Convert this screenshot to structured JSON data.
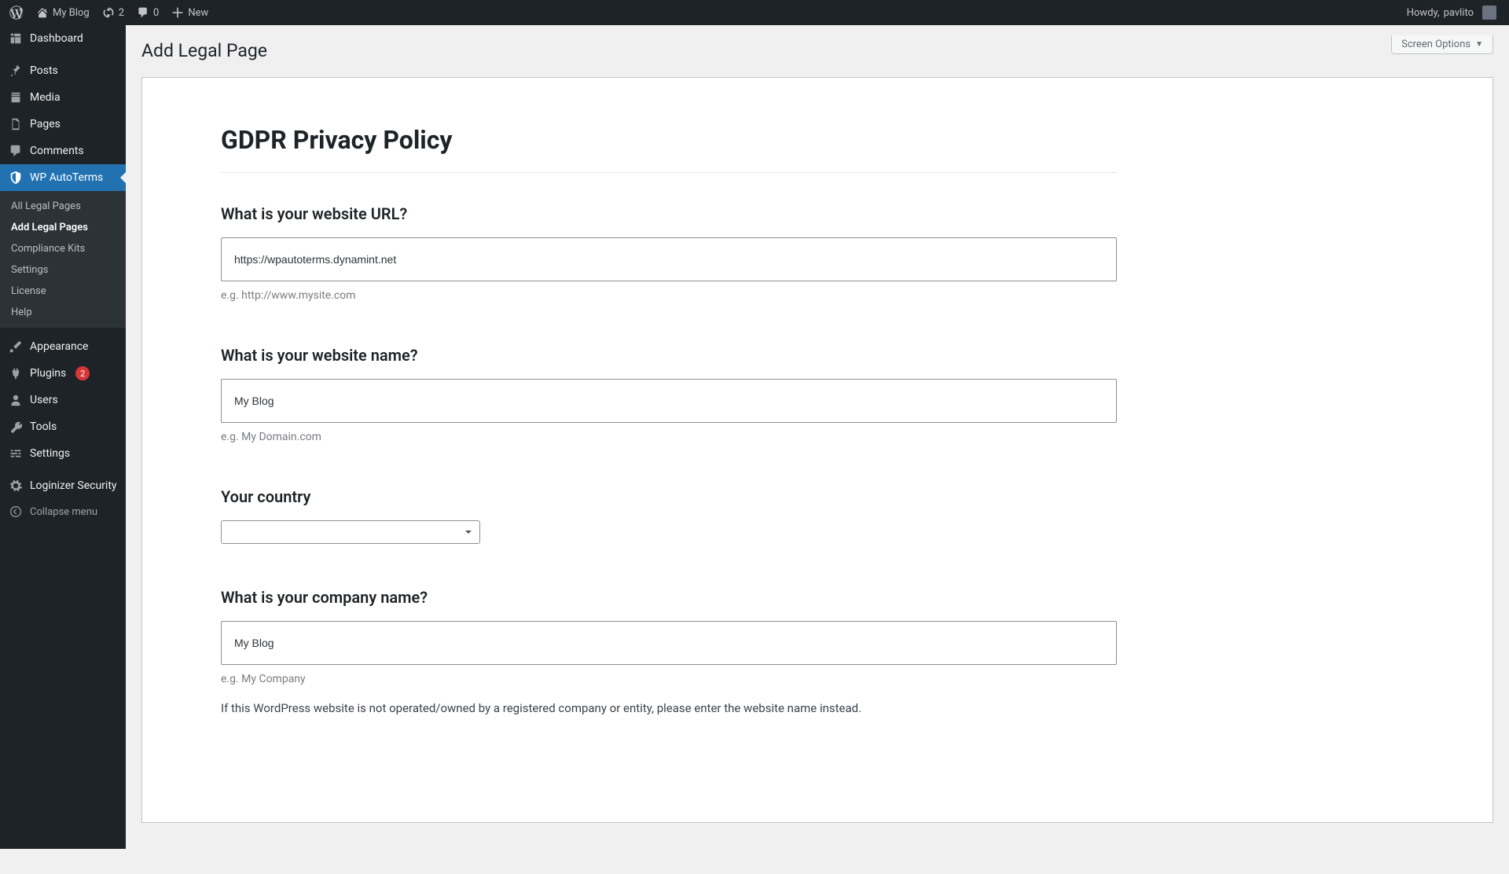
{
  "adminbar": {
    "site_name": "My Blog",
    "updates_count": "2",
    "comments_count": "0",
    "new_label": "New",
    "howdy_prefix": "Howdy,",
    "username": "pavlito"
  },
  "sidebar": {
    "dashboard": "Dashboard",
    "posts": "Posts",
    "media": "Media",
    "pages": "Pages",
    "comments": "Comments",
    "autoterms": "WP AutoTerms",
    "appearance": "Appearance",
    "plugins": "Plugins",
    "plugins_badge": "2",
    "users": "Users",
    "tools": "Tools",
    "settings": "Settings",
    "loginizer": "Loginizer Security",
    "collapse": "Collapse menu",
    "sub": {
      "all_legal": "All Legal Pages",
      "add_legal": "Add Legal Pages",
      "kits": "Compliance Kits",
      "settings": "Settings",
      "license": "License",
      "help": "Help"
    }
  },
  "header": {
    "title": "Add Legal Page",
    "screen_options": "Screen Options"
  },
  "form": {
    "title": "GDPR Privacy Policy",
    "url": {
      "label": "What is your website URL?",
      "value": "https://wpautoterms.dynamint.net",
      "hint": "e.g. http://www.mysite.com"
    },
    "name": {
      "label": "What is your website name?",
      "value": "My Blog",
      "hint": "e.g. My Domain.com"
    },
    "country": {
      "label": "Your country",
      "value": ""
    },
    "company": {
      "label": "What is your company name?",
      "value": "My Blog",
      "hint": "e.g. My Company",
      "note": "If this WordPress website is not operated/owned by a registered company or entity, please enter the website name instead."
    }
  }
}
